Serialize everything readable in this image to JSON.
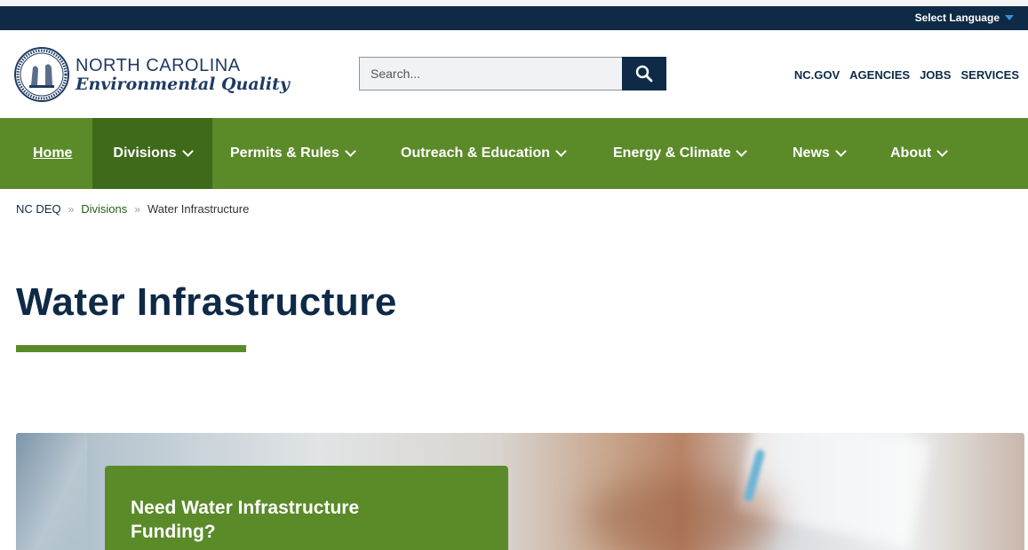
{
  "topbar": {
    "language_label": "Select Language"
  },
  "brand": {
    "line1": "NORTH CAROLINA",
    "line2": "Environmental Quality"
  },
  "search": {
    "placeholder": "Search..."
  },
  "utility_nav": [
    "NC.GOV",
    "AGENCIES",
    "JOBS",
    "SERVICES"
  ],
  "main_nav": [
    {
      "label": "Home",
      "dropdown": false
    },
    {
      "label": "Divisions",
      "dropdown": true,
      "active": true
    },
    {
      "label": "Permits & Rules",
      "dropdown": true
    },
    {
      "label": "Outreach & Education",
      "dropdown": true
    },
    {
      "label": "Energy & Climate",
      "dropdown": true
    },
    {
      "label": "News",
      "dropdown": true
    },
    {
      "label": "About",
      "dropdown": true
    }
  ],
  "breadcrumb": {
    "items": [
      "NC DEQ",
      "Divisions",
      "Water Infrastructure"
    ],
    "separator": "»"
  },
  "page": {
    "title": "Water Infrastructure"
  },
  "hero": {
    "callout_title": "Need Water Infrastructure Funding?"
  },
  "colors": {
    "navy": "#0e2a47",
    "green": "#5b8a29",
    "green_dark": "#3f6a1a",
    "accent_blue": "#3a8fd6"
  },
  "icons": {
    "search": "search-icon",
    "language_caret": "caret-down-icon",
    "nav_chevron": "chevron-down-icon",
    "seal": "state-seal-icon"
  }
}
